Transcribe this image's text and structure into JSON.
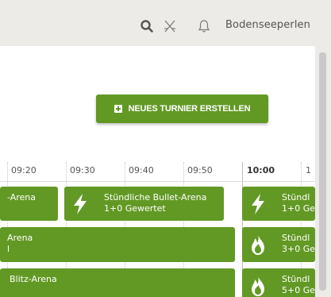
{
  "header": {
    "username": "Bodenseeperlen",
    "icons": [
      "search-icon",
      "swords-icon",
      "bell-icon"
    ]
  },
  "actions": {
    "create_tournament": "NEUES TURNIER ERSTELLEN"
  },
  "timeline": {
    "ticks": [
      "09:20",
      "09:30",
      "09:40",
      "09:50",
      "10:00",
      "1"
    ],
    "current_tick": "10:00"
  },
  "tournaments": [
    {
      "title": "-Arena"
    },
    {
      "title": "Stündliche Bullet-Arena",
      "detail": "1+0 Gewertet",
      "icon": "lightning-icon"
    },
    {
      "title": "Stündl",
      "detail": "1+0 Ge",
      "icon": "lightning-icon"
    },
    {
      "title": "Arena",
      "detail": "l"
    },
    {
      "title": "Stündl",
      "detail": "3+0 Ge",
      "icon": "flame-icon"
    },
    {
      "title": "Blitz-Arena"
    },
    {
      "title": "Stündl",
      "detail": "5+0 Ge",
      "icon": "flame-icon"
    }
  ],
  "colors": {
    "accent": "#629924",
    "page_bg": "#ecebe8",
    "panel_bg": "#ffffff"
  }
}
